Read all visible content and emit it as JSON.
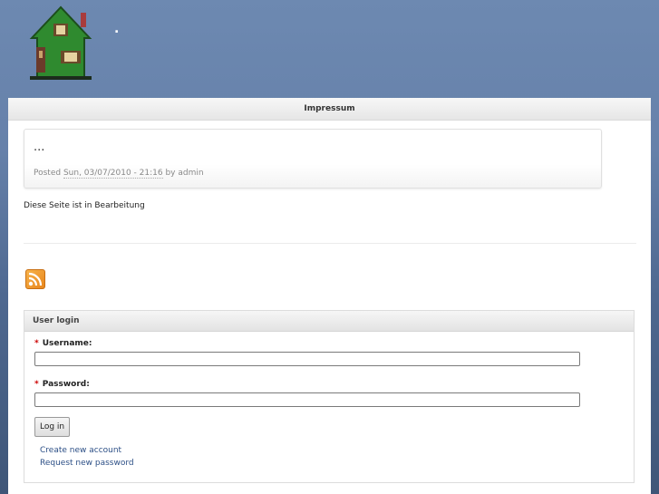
{
  "header": {
    "site_name": "."
  },
  "tabs": {
    "active": "Impressum"
  },
  "node": {
    "title": "...",
    "posted_prefix": "Posted",
    "date": "Sun, 03/07/2010 - 21:16",
    "by": "by",
    "author": "admin"
  },
  "content": {
    "body": "Diese Seite ist in Bearbeitung"
  },
  "feed": {
    "icon": "rss-feed-icon"
  },
  "login": {
    "title": "User login",
    "username_label": "Username:",
    "password_label": "Password:",
    "required_mark": "*",
    "username_value": "",
    "password_value": "",
    "submit_label": "Log in",
    "create_account": "Create new account",
    "request_password": "Request new password"
  },
  "colors": {
    "header_top": "#6d89b1",
    "header_bottom": "#3f5678",
    "link": "#2c4f86",
    "required": "#cc0000"
  }
}
